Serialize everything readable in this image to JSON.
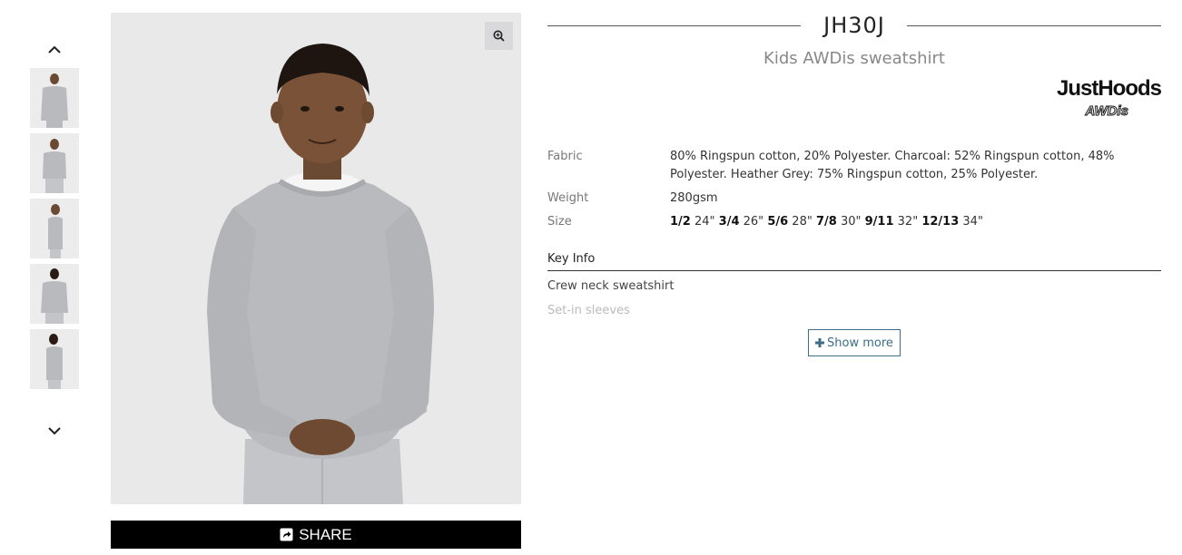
{
  "product": {
    "code": "JH30J",
    "name": "Kids AWDis sweatshirt"
  },
  "brand": {
    "logo_main": "JustHoods",
    "logo_sub": "AWDis"
  },
  "gallery": {
    "thumbnail_count": 5,
    "prev_icon": "chevron-up-icon",
    "next_icon": "chevron-down-icon",
    "zoom_icon": "zoom-in-icon"
  },
  "share": {
    "label": "SHARE",
    "icon": "share-icon"
  },
  "specs": {
    "fabric_label": "Fabric",
    "fabric_value": "80% Ringspun cotton, 20% Polyester. Charcoal: 52% Ringspun cotton, 48% Polyester. Heather Grey: 75% Ringspun cotton, 25% Polyester.",
    "weight_label": "Weight",
    "weight_value": "280gsm",
    "size_label": "Size",
    "sizes": [
      {
        "size": "1/2",
        "measure": "24\""
      },
      {
        "size": "3/4",
        "measure": "26\""
      },
      {
        "size": "5/6",
        "measure": "28\""
      },
      {
        "size": "7/8",
        "measure": "30\""
      },
      {
        "size": "9/11",
        "measure": "32\""
      },
      {
        "size": "12/13",
        "measure": "34\""
      }
    ]
  },
  "key_info": {
    "title": "Key Info",
    "features": [
      "Crew neck sweatshirt",
      "Set-in sleeves"
    ],
    "show_more_label": "Show more"
  },
  "colors": {
    "share_bg": "#000000",
    "accent": "#3d6e86",
    "image_bg": "#e9e9ea",
    "sweatshirt": "#b9babd"
  }
}
